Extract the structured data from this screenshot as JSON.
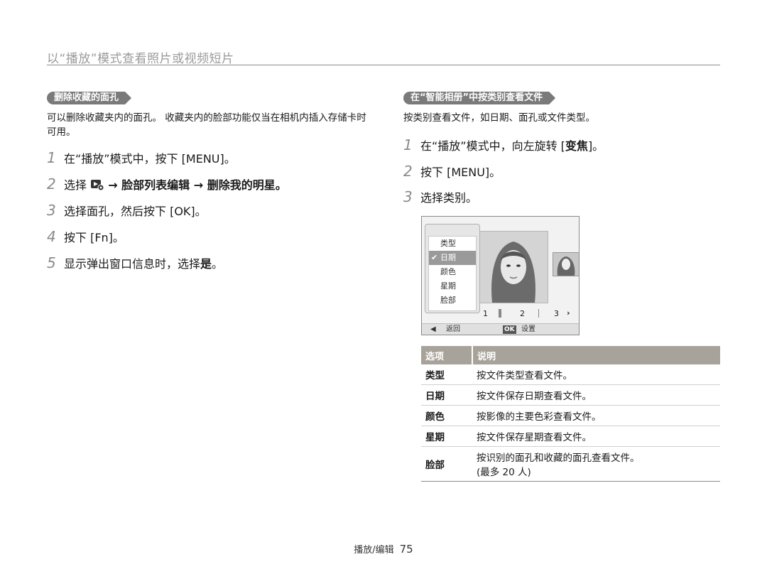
{
  "header": {
    "title": "以“播放”模式查看照片或视频短片"
  },
  "left": {
    "pill": "删除收藏的面孔",
    "intro": "可以删除收藏夹内的面孔。 收藏夹内的脸部功能仅当在相机内插入存储卡时可用。",
    "steps": [
      {
        "num": "1",
        "text": "在“播放”模式中，按下 [MENU]。"
      },
      {
        "num": "2",
        "pre": "选择",
        "post": "→ 脸部列表编辑 → 删除我的明星。"
      },
      {
        "num": "3",
        "text": "选择面孔，然后按下 [OK]。"
      },
      {
        "num": "4",
        "text": "按下 [Fn]。"
      },
      {
        "num": "5",
        "pre": "显示弹出窗口信息时，选择",
        "bold": "是",
        "post": "。"
      }
    ]
  },
  "right": {
    "pill": "在“智能相册”中按类别查看文件",
    "intro": "按类别查看文件，如日期、面孔或文件类型。",
    "steps": [
      {
        "num": "1",
        "pre": "在“播放”模式中，向左旋转 [",
        "bold": "变焦",
        "post": "]。"
      },
      {
        "num": "2",
        "text": "按下 [MENU]。"
      },
      {
        "num": "3",
        "text": "选择类别。"
      }
    ],
    "screen": {
      "menu_items": [
        "类型",
        "日期",
        "颜色",
        "星期",
        "脸部"
      ],
      "selected_index": 1,
      "pages": [
        "1",
        "2",
        "3"
      ],
      "back_label": "返回",
      "ok_key": "OK",
      "ok_label": "设置"
    },
    "table": {
      "headers": [
        "选项",
        "说明"
      ],
      "rows": [
        [
          "类型",
          "按文件类型查看文件。"
        ],
        [
          "日期",
          "按文件保存日期查看文件。"
        ],
        [
          "颜色",
          "按影像的主要色彩查看文件。"
        ],
        [
          "星期",
          "按文件保存星期查看文件。"
        ],
        [
          "脸部",
          "按识别的面孔和收藏的面孔查看文件。",
          "(最多 20 人)"
        ]
      ]
    }
  },
  "footer": {
    "section": "播放/编辑",
    "page": "75"
  }
}
